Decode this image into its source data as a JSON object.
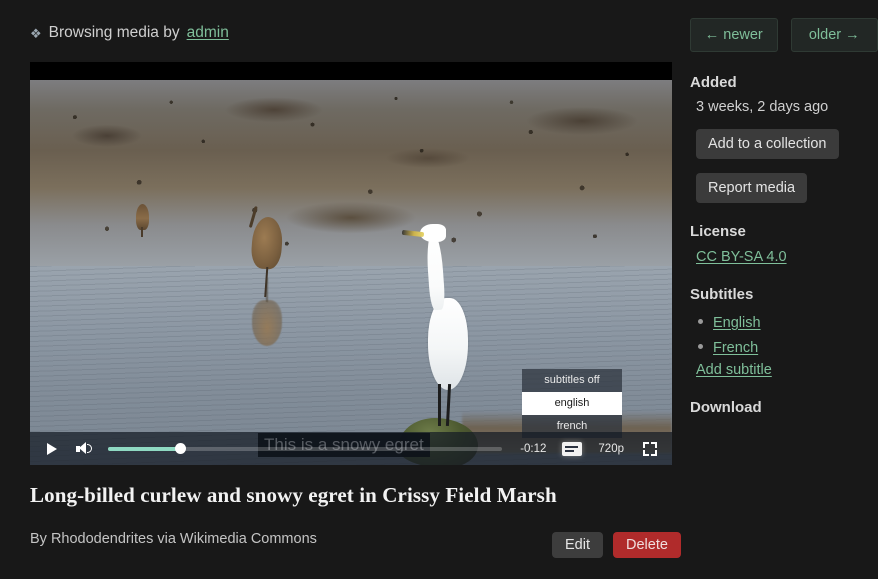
{
  "header": {
    "icon": "diamond-icon",
    "prefix": "Browsing media by",
    "user": "admin"
  },
  "player": {
    "caption_text": "This is a snowy egret",
    "time_remaining": "-0:12",
    "quality": "720p",
    "play_icon": "play-icon",
    "volume_icon": "volume-icon",
    "subtitles_icon": "closed-captions-icon",
    "fullscreen_icon": "fullscreen-icon",
    "progress_percent": 18.5,
    "subtitle_menu": {
      "options": [
        "subtitles off",
        "english",
        "french"
      ],
      "selected": "english"
    }
  },
  "media": {
    "title": "Long-billed curlew and snowy egret in Crissy Field Marsh",
    "attribution": "By Rhododendrites via Wikimedia Commons",
    "edit_label": "Edit",
    "delete_label": "Delete"
  },
  "sidebar": {
    "pager": {
      "newer_label": "← newer",
      "older_label": "older →"
    },
    "added": {
      "heading": "Added",
      "value": "3 weeks, 2 days ago"
    },
    "add_collection_label": "Add to a collection",
    "report_label": "Report media",
    "license": {
      "heading": "License",
      "value": "CC BY-SA 4.0"
    },
    "subtitles": {
      "heading": "Subtitles",
      "items": [
        "English",
        "French"
      ],
      "add_label": "Add subtitle"
    },
    "download": {
      "heading": "Download"
    }
  },
  "colors": {
    "background": "#181818",
    "link": "#7fbf9a",
    "delete": "#b02b2b",
    "progress_fill": "#8fd9c2"
  }
}
